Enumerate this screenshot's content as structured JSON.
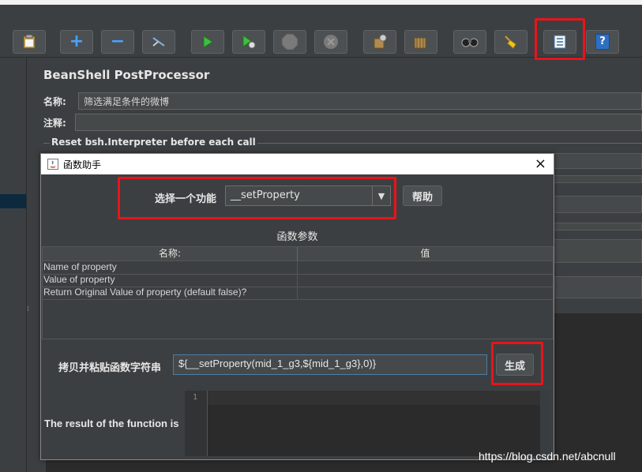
{
  "colors": {
    "highlight_box": "#e8141c",
    "background": "#3c3f41",
    "dialog_title_bg": "#ffffff"
  },
  "toolbar": {
    "buttons": [
      {
        "icon": "clipboard-icon"
      },
      {
        "icon": "plus-icon",
        "text": "+"
      },
      {
        "icon": "minus-icon",
        "text": "−"
      },
      {
        "icon": "wand-icon"
      },
      {
        "icon": "run-icon"
      },
      {
        "icon": "run-no-pause-icon"
      },
      {
        "icon": "stop-icon"
      },
      {
        "icon": "shutdown-icon"
      },
      {
        "icon": "clear-icon"
      },
      {
        "icon": "clear-all-icon"
      },
      {
        "icon": "search-binoculars-icon"
      },
      {
        "icon": "reset-broom-icon"
      },
      {
        "icon": "function-helper-icon"
      },
      {
        "icon": "help-icon",
        "text": "?"
      }
    ]
  },
  "panel": {
    "title": "BeanShell PostProcessor",
    "name_label": "名称:",
    "name_value": "筛选满足条件的微博",
    "comment_label": "注释:",
    "comment_value": "",
    "reset_label": "Reset bsh.Interpreter before each call"
  },
  "dialog": {
    "title": "函数助手",
    "close": "×",
    "choose_label": "选择一个功能",
    "selected_function": "__setProperty",
    "help_button": "帮助",
    "params_title": "函数参数",
    "table": {
      "headers": [
        "名称:",
        "值"
      ],
      "rows": [
        {
          "name": "Name of property",
          "value": ""
        },
        {
          "name": "Value of property",
          "value": ""
        },
        {
          "name": "Return Original Value of property (default false)?",
          "value": ""
        }
      ]
    },
    "copy_label": "拷贝并粘贴函数字符串",
    "function_string": "${__setProperty(mid_1_g3,${mid_1_g3},0)}",
    "generate_button": "生成",
    "result_label": "The result of the function is",
    "result_line_number": "1"
  },
  "watermark": "https://blog.csdn.net/abcnull"
}
